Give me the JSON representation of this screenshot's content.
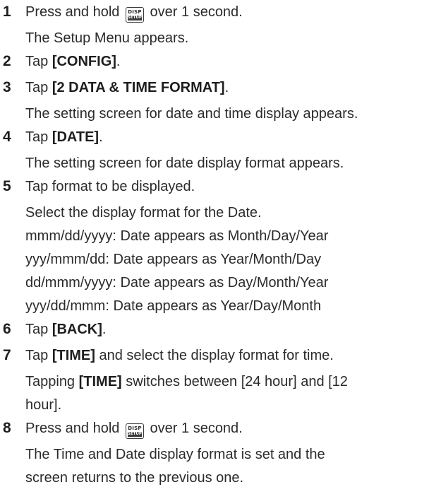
{
  "button_icon": {
    "top": "DISP",
    "bottom": "SETUP"
  },
  "steps": [
    {
      "number": "1",
      "before": "Press and hold",
      "after": "over 1 second.",
      "sub": [
        "The Setup Menu appears."
      ]
    },
    {
      "number": "2",
      "prefix": "Tap",
      "bold": "[CONFIG]",
      "suffix": "."
    },
    {
      "number": "3",
      "prefix": "Tap",
      "bold": "[2 DATA & TIME FORMAT]",
      "suffix": ".",
      "sub": [
        "The setting screen for date and time display appears."
      ]
    },
    {
      "number": "4",
      "prefix": "Tap",
      "bold": "[DATE]",
      "suffix": ".",
      "sub": [
        "The setting screen for date display format appears."
      ]
    },
    {
      "number": "5",
      "text": "Tap format to be displayed.",
      "sub": [
        "Select the display format for the Date.",
        "mmm/dd/yyyy: Date appears as Month/Day/Year",
        "yyy/mmm/dd: Date appears as Year/Month/Day",
        "dd/mmm/yyyy: Date appears as Day/Month/Year",
        "yyy/dd/mmm: Date appears as Year/Day/Month"
      ]
    },
    {
      "number": "6",
      "prefix": "Tap",
      "bold": "[BACK]",
      "suffix": "."
    },
    {
      "number": "7",
      "prefix": "Tap",
      "bold": "[TIME]",
      "suffix": "and select the display format for time.",
      "sub_prefix": "Tapping",
      "sub_bold": "[TIME]",
      "sub_suffix": "switches between [24 hour] and [12",
      "sub_continued": "hour]."
    },
    {
      "number": "8",
      "before": "Press and hold",
      "after": "over 1 second.",
      "sub": [
        "The Time and Date display format is set and the",
        "screen returns to the previous one."
      ]
    }
  ]
}
